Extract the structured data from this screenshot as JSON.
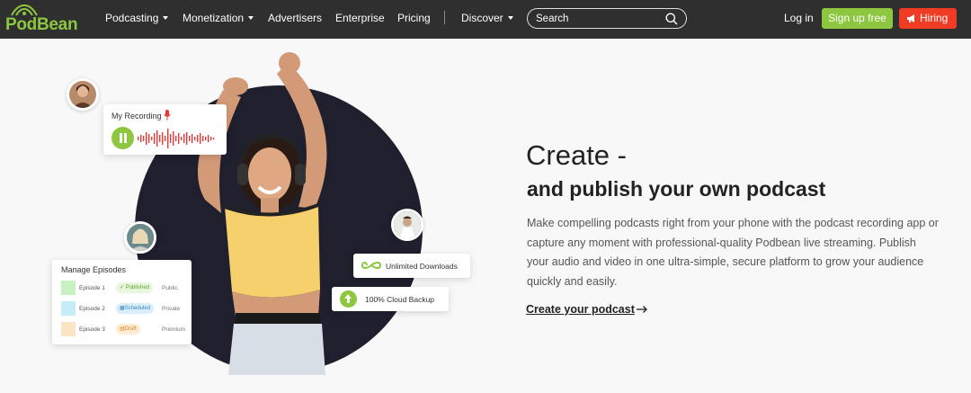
{
  "brand": {
    "logo_text": "PodBean",
    "brand_green": "#8dc63f",
    "nav_bg": "#2f2f2f",
    "hiring_red": "#f03c24"
  },
  "nav": {
    "items": [
      {
        "label": "Podcasting",
        "dropdown": true
      },
      {
        "label": "Monetization",
        "dropdown": true
      },
      {
        "label": "Advertisers",
        "dropdown": false
      },
      {
        "label": "Enterprise",
        "dropdown": false
      },
      {
        "label": "Pricing",
        "dropdown": false
      },
      {
        "label": "Discover",
        "dropdown": true
      }
    ],
    "search_placeholder": "Search",
    "login_label": "Log in",
    "signup_label": "Sign up free",
    "hiring_label": "Hiring"
  },
  "hero": {
    "heading_line1": "Create -",
    "heading_line2": "and publish your own podcast",
    "description": "Make compelling podcasts right from your phone with the podcast recording app or capture any moment with professional-quality Podbean live streaming. Publish your audio and video in one ultra-simple, secure platform to grow your audience quickly and easily.",
    "cta_label": "Create your podcast"
  },
  "recording_card": {
    "title": "My Recording"
  },
  "episodes_card": {
    "title": "Manage Episodes",
    "rows": [
      {
        "name": "Episode 1",
        "status": "Published",
        "visibility": "Public",
        "thumb_color": "#c8f0c0",
        "status_bg": "#e8f7de",
        "status_color": "#5aa02c",
        "status_icon": "check-icon"
      },
      {
        "name": "Episode 2",
        "status": "Scheduled",
        "visibility": "Private",
        "thumb_color": "#c6ecf7",
        "status_bg": "#d9eefa",
        "status_color": "#3a86b8",
        "status_icon": "calendar-icon"
      },
      {
        "name": "Episode 3",
        "status": "Draft",
        "visibility": "Premium",
        "thumb_color": "#fbe5c6",
        "status_bg": "#fdebd3",
        "status_color": "#d98a2b",
        "status_icon": "draft-icon"
      }
    ]
  },
  "feature_badges": {
    "downloads": "Unlimited Downloads",
    "backup": "100% Cloud Backup"
  }
}
